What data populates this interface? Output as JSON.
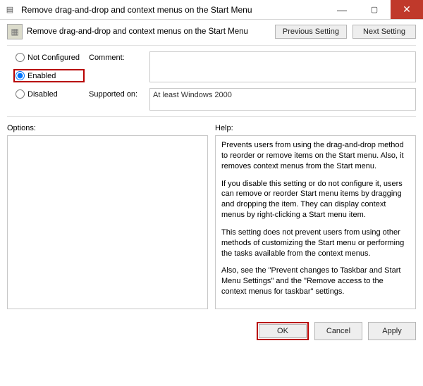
{
  "window": {
    "title": "Remove drag-and-drop and context menus on the Start Menu"
  },
  "header": {
    "text": "Remove drag-and-drop and context menus on the Start Menu",
    "prev_label": "Previous Setting",
    "next_label": "Next Setting"
  },
  "radios": {
    "not_configured": "Not Configured",
    "enabled": "Enabled",
    "disabled": "Disabled",
    "selected": "enabled"
  },
  "comment": {
    "label": "Comment:",
    "value": ""
  },
  "supported": {
    "label": "Supported on:",
    "value": "At least Windows 2000"
  },
  "options": {
    "label": "Options:",
    "content": ""
  },
  "help": {
    "label": "Help:",
    "paragraphs": [
      "Prevents users from using the drag-and-drop method to reorder or remove items on the Start menu. Also, it removes context menus from the Start menu.",
      "If you disable this setting or do not configure it, users can remove or reorder Start menu items by dragging and dropping the item. They can display context menus by right-clicking a Start menu item.",
      "This setting does not prevent users from using other methods of customizing the Start menu or performing the tasks available from the context menus.",
      "Also, see the \"Prevent changes to Taskbar and Start Menu Settings\" and the \"Remove access to the context menus for taskbar\" settings."
    ]
  },
  "footer": {
    "ok": "OK",
    "cancel": "Cancel",
    "apply": "Apply"
  }
}
